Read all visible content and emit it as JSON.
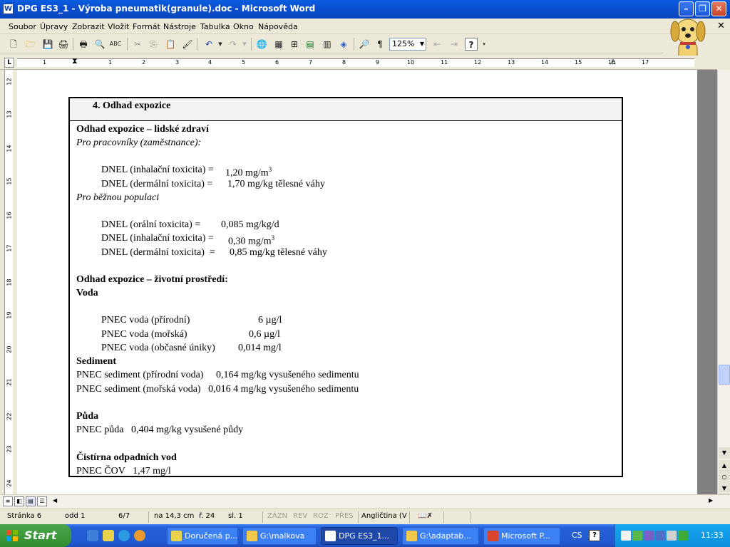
{
  "window": {
    "title": "DPG ES3_1 - Výroba pneumatik(granule).doc - Microsoft Word",
    "app_icon": "W"
  },
  "menu": [
    "Soubor",
    "Úpravy",
    "Zobrazit",
    "Vložit",
    "Formát",
    "Nástroje",
    "Tabulka",
    "Okno",
    "Nápověda"
  ],
  "toolbar": {
    "zoom": "125%",
    "pilcrow": "¶",
    "help": "?"
  },
  "ruler": {
    "tab_selector": "L",
    "h_numbers": [
      "1",
      "1",
      "2",
      "3",
      "4",
      "5",
      "6",
      "7",
      "8",
      "9",
      "10",
      "11",
      "12",
      "13",
      "14",
      "15",
      "16",
      "17"
    ],
    "v_numbers": [
      "12",
      "13",
      "14",
      "15",
      "16",
      "17",
      "18",
      "19",
      "20",
      "21",
      "22",
      "23",
      "24"
    ]
  },
  "document": {
    "section_heading": "4. Odhad expozice",
    "human_heading": "Odhad expozice – lidské zdraví",
    "workers_label": "Pro pracovníky (zaměstnance):",
    "workers": [
      {
        "label": "DNEL (inhalační toxicita) =",
        "value": "1,20 mg/m",
        "sup": "3"
      },
      {
        "label": "DNEL (dermální toxicita) =",
        "value": "1,70 mg/kg tělesné váhy",
        "sup": ""
      }
    ],
    "population_label": "Pro běžnou populaci",
    "population": [
      {
        "label": "DNEL (orální toxicita) =",
        "value": "0,085 mg/kg/d",
        "sup": ""
      },
      {
        "label": "DNEL (inhalační toxicita) =",
        "value": "0,30 mg/m",
        "sup": "3"
      },
      {
        "label": "DNEL (dermální toxicita)  =",
        "value": "0,85 mg/kg tělesné váhy",
        "sup": ""
      }
    ],
    "env_heading": "Odhad expozice – životní prostředí:",
    "water_heading": "Voda",
    "water": [
      {
        "label": "PNEC voda (přírodní)",
        "value": "6 µg/l"
      },
      {
        "label": "PNEC voda (mořská)",
        "value": "0,6 µg/l"
      },
      {
        "label": "PNEC voda (občasné úniky)",
        "value": "0,014 mg/l"
      }
    ],
    "sediment_heading": "Sediment",
    "sediment": [
      "PNEC sediment (přírodní voda)     0,164 mg/kg vysušeného sedimentu",
      "PNEC sediment (mořská voda)   0,016 4 mg/kg vysušeného sedimentu"
    ],
    "soil_heading": "Půda",
    "soil": "PNEC půda   0,404 mg/kg vysušené půdy",
    "stp_heading": "Čistírna odpadních vod",
    "stp": "PNEC ČOV   1,47 mg/l"
  },
  "status": {
    "page": "Stránka  6",
    "section": "odd  1",
    "pages": "6/7",
    "position": "na  14,3 cm",
    "line": "ř.  24",
    "column": "sl.  1",
    "rec": "ZÁZN",
    "trk": "REV",
    "ext": "ROZ",
    "ovr": "PŘES",
    "language": "Angličtina (V"
  },
  "taskbar": {
    "start": "Start",
    "tasks": [
      "Doručená p...",
      "G:\\malkova",
      "DPG ES3_1...",
      "G:\\adaptab...",
      "Microsoft P..."
    ],
    "language": "CS",
    "help": "?",
    "clock": "11:33"
  }
}
